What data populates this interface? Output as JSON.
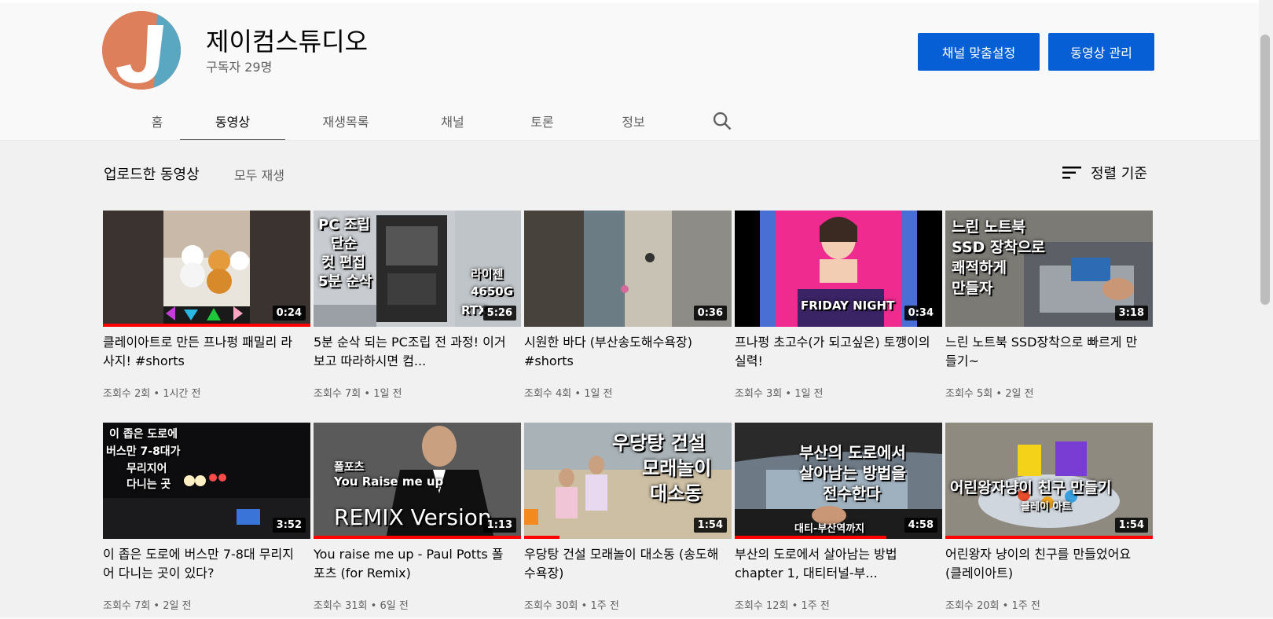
{
  "channel": {
    "title": "제이컴스튜디오",
    "subscribers": "구독자 29명",
    "customize_label": "채널 맞춤설정",
    "manage_label": "동영상 관리"
  },
  "tabs": [
    {
      "label": "홈"
    },
    {
      "label": "동영상",
      "active": true
    },
    {
      "label": "재생목록"
    },
    {
      "label": "채널"
    },
    {
      "label": "토론"
    },
    {
      "label": "정보"
    }
  ],
  "section": {
    "title": "업로드한 동영상",
    "play_all": "모두 재생",
    "sort_label": "정렬 기준"
  },
  "videos": [
    {
      "title": "클레이아트로 만든 프나펑 패밀리 라사지! #shorts",
      "views": "조회수 2회",
      "age": "1시간 전",
      "duration": "0:24",
      "progress": 1.0
    },
    {
      "title": "5분 순삭 되는 PC조립 전 과정! 이거 보고 따라하시면 컴...",
      "views": "조회수 7회",
      "age": "1일 전",
      "duration": "5:26",
      "progress": 0
    },
    {
      "title": "시원한 바다 (부산송도해수욕장) #shorts",
      "views": "조회수 4회",
      "age": "1일 전",
      "duration": "0:36",
      "progress": 0
    },
    {
      "title": "프나펑 초고수(가 되고싶은) 토깽이의 실력!",
      "views": "조회수 3회",
      "age": "1일 전",
      "duration": "0:34",
      "progress": 0
    },
    {
      "title": "느린 노트북 SSD장착으로 빠르게 만들기~",
      "views": "조회수 5회",
      "age": "2일 전",
      "duration": "3:18",
      "progress": 0
    },
    {
      "title": "이 좁은 도로에 버스만 7-8대 무리지어 다니는 곳이 있다?",
      "views": "조회수 7회",
      "age": "2일 전",
      "duration": "3:52",
      "progress": 0
    },
    {
      "title": "You raise me up - Paul Potts 폴포츠 (for Remix)",
      "views": "조회수 31회",
      "age": "6일 전",
      "duration": "1:13",
      "progress": 1.0
    },
    {
      "title": "우당탕 건설 모래놀이 대소동 (송도해수욕장)",
      "views": "조회수 30회",
      "age": "1주 전",
      "duration": "1:54",
      "progress": 0.17
    },
    {
      "title": "부산의 도로에서 살아남는 방법 chapter 1, 대티터널-부...",
      "views": "조회수 12회",
      "age": "1주 전",
      "duration": "4:58",
      "progress": 0.73
    },
    {
      "title": "어린왕자 냥이의 친구를 만들었어요 (클레이아트)",
      "views": "조회수 20회",
      "age": "1주 전",
      "duration": "1:54",
      "progress": 1.0
    }
  ],
  "thumb_text": {
    "v1": {
      "l1": "PC 조립",
      "l2": "단순",
      "l3": "컷 편집",
      "l4": "5분 순삭",
      "l5": "라이젠",
      "l6": "4650G",
      "l7": "RTX"
    },
    "v3": {
      "l1": "FRIDAY NIGHT"
    },
    "v4": {
      "l1": "느린 노트북",
      "l2": "SSD 장착으로",
      "l3": "쾌적하게",
      "l4": "만들자"
    },
    "v5": {
      "l1": "이 좁은 도로에",
      "l2": "버스만 7-8대가",
      "l3": "무리지어",
      "l4": "다니는 곳"
    },
    "v6": {
      "l1": "폴포츠",
      "l2": "You Raise me up",
      "l3": "REMIX Version"
    },
    "v7": {
      "l1": "우당탕 건설",
      "l2": "모래놀이",
      "l3": "대소동"
    },
    "v8": {
      "l1": "부산의 도로에서",
      "l2": "살아남는 방법을",
      "l3": "전수한다",
      "l4": "대티-부산역까지"
    },
    "v9": {
      "l1": "어린왕자냥이 친구 만들기",
      "l2": "클레이 아트"
    }
  },
  "colors": {
    "accent": "#065fd4",
    "progress": "#ff0000",
    "bg": "#f9f9f9",
    "content_bg": "#f1f1f1"
  }
}
